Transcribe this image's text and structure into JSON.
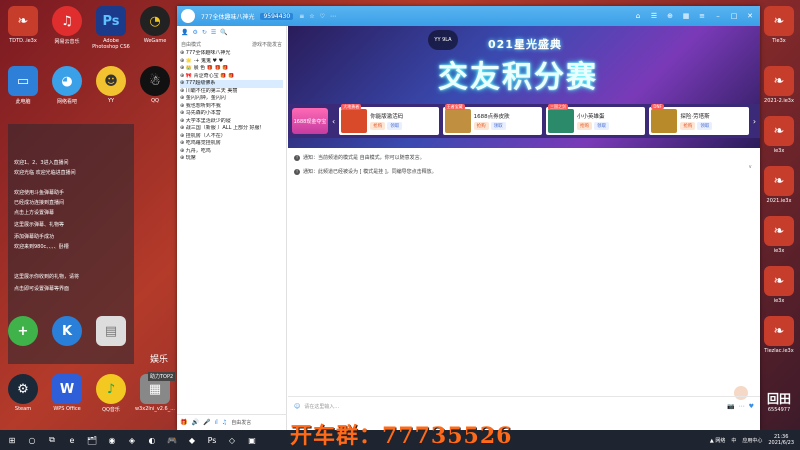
{
  "desktop": {
    "icons": [
      {
        "label": "TDTD..ie3x",
        "glyph": "stripe-icon",
        "color": "#c73d2c"
      },
      {
        "label": "网易云音乐",
        "glyph": "cloudmusic-icon",
        "color": "#e02e2e"
      },
      {
        "label": "Adobe Photoshop CS6",
        "glyph": "Ps",
        "color": "#1b3a8a"
      },
      {
        "label": "WeGame",
        "glyph": "wegame-icon",
        "color": "#222"
      },
      {
        "label": "此电脑",
        "glyph": "pc-icon",
        "color": "#2d7fd8"
      },
      {
        "label": "网络看吧",
        "glyph": "bubble-icon",
        "color": "#3aa0e8"
      },
      {
        "label": "YY",
        "glyph": "yy-icon",
        "color": "#f2c230"
      },
      {
        "label": "QQ",
        "glyph": "penguin-icon",
        "color": "#111"
      }
    ],
    "overlay_lines": [
      "欢迎1、2、3进入直播间",
      "欢迎光临 欢迎光临进直播间",
      "欢迎使用斗鱼弹幕助手",
      "已经成功连接到直播间",
      "点击上方设置弹幕",
      "这里展示弹幕、礼物等",
      "添加弹幕助手成功",
      "欢迎来到980c、、、、卧槽",
      "这里展示你收到的礼物，请将",
      "点击即可设置弹幕等界面"
    ],
    "right_labels": [
      "Tie3x",
      "2021-2.ie3x",
      "ie3x",
      "2021.ie3x",
      "ie3x",
      "ie3x",
      "Tiezlac.ie3x"
    ],
    "bottom_icons": [
      {
        "label": "Steam",
        "glyph": "steam-icon",
        "color": "#1b2838"
      },
      {
        "label": "WPS Office",
        "glyph": "W",
        "color": "#2e5fd8"
      },
      {
        "label": "QQ音乐",
        "glyph": "qqmusic-icon",
        "color": "#f3c821"
      },
      {
        "label": "w3x2lni_v2.6_...",
        "glyph": "file-icon",
        "color": "#888"
      }
    ],
    "side_text": "娱乐",
    "side_small": "助力TOP2",
    "right_brand_big": "回田",
    "right_brand_num": "6554977"
  },
  "window": {
    "title": "777全体趣味八神光",
    "room_id": "9594430",
    "title_icons": [
      "≡",
      "☆",
      "♡",
      "⋯"
    ],
    "controls": [
      "home-icon",
      "list-icon",
      "game-icon",
      "grid-icon",
      "menu-icon",
      "minimize-icon",
      "maximize-icon",
      "close-icon"
    ]
  },
  "left_pane": {
    "channel_label": "自由模式",
    "channel_right": "游戏不能发言",
    "tree": [
      {
        "text": "⊕ 777全体趣味八神光",
        "sel": false
      },
      {
        "text": "  ⊕ 🌟 ·+ 鬼鬼 ♥ ♥",
        "sel": false
      },
      {
        "text": "  ⊕ 👑 晨 色 🎁 🎁 🎁",
        "sel": false
      },
      {
        "text": "  ⊕ 🎀 青涩奇心宝 🎁 🎁",
        "sel": false
      },
      {
        "text": "  ⊕ 777超级佛系",
        "sel": true
      },
      {
        "text": "  ⊕ 川霸不住的第三天 美丽",
        "sel": false
      },
      {
        "text": "  ⊕ 金闪闪钟，金闪闪",
        "sel": false
      },
      {
        "text": "  ⊕ 我也想听到不我",
        "sel": false
      },
      {
        "text": "  ⊕ 马先森的小本营",
        "sel": false
      },
      {
        "text": "  ⊕ 大学本里活跃少的寝",
        "sel": false
      },
      {
        "text": "  ⊕ 战三国（新服 ）ALL 上部分 好服！",
        "sel": false
      },
      {
        "text": "  ⊕ 挂机房（人不在）",
        "sel": false
      },
      {
        "text": "  ⊕ 吃鸡睡觉挂机房",
        "sel": false
      },
      {
        "text": "  ⊕ 九舟，吃鸡",
        "sel": false
      },
      {
        "text": "  ⊕ 玩席",
        "sel": false
      }
    ],
    "bottom_icons": [
      "🎁",
      "🔊",
      "🎤",
      "ıl",
      "♫"
    ],
    "free_label": "自由发言"
  },
  "banner": {
    "badge": "YY 9LA",
    "headline_small": "021星光盛典",
    "headline_big": "交友积分赛",
    "promo_tag": "1688现金夺宝",
    "promos": [
      {
        "corner": "大地勇者",
        "name": "你能版激活码",
        "thumb": "#d94a2a"
      },
      {
        "corner": "王者宝藏",
        "name": "1688点券皮肤",
        "thumb": "#c09040"
      },
      {
        "corner": "三国之剑",
        "name": "小小英雄蛋",
        "thumb": "#2a8a6a"
      },
      {
        "corner": "DNF",
        "name": "探险·劳塔斯",
        "thumb": "#b88a2a"
      }
    ],
    "buy": "抢购",
    "gift": "领取"
  },
  "chat": {
    "messages": [
      "通知：当前频道的模式是 自由模式，你可以随意发言。",
      "通知：此频道已经被设为 [ 模式是挂 ]，同编导您点击释放。"
    ],
    "scroll_marker": "∨"
  },
  "input": {
    "placeholder": "请在这里输入...",
    "icons": [
      "☺",
      "📷",
      "⋯",
      "♥"
    ]
  },
  "taskbar": {
    "apps": [
      "⊞",
      "○",
      "⧉",
      "e",
      "🗂",
      "◉",
      "◈",
      "◐",
      "🎮",
      "◆",
      "Ps",
      "◇",
      "▣"
    ],
    "tray_labels": [
      "▲ 网络",
      "中",
      "应用中心"
    ],
    "time": "21:36",
    "date": "2021/6/23"
  },
  "watermark": "开车群：77735526"
}
